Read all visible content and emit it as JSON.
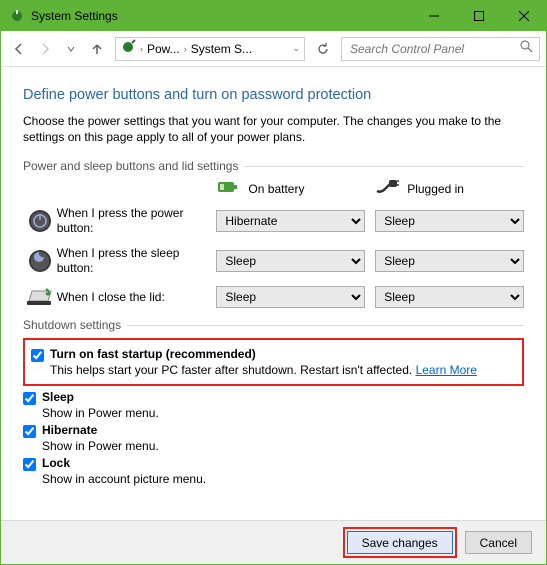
{
  "window": {
    "title": "System Settings"
  },
  "nav": {
    "breadcrumb": {
      "item1": "Pow...",
      "item2": "System S..."
    },
    "search_placeholder": "Search Control Panel"
  },
  "header": {
    "heading": "Define power buttons and turn on password protection",
    "intro": "Choose the power settings that you want for your computer. The changes you make to the settings on this page apply to all of your power plans."
  },
  "section_power": {
    "legend": "Power and sleep buttons and lid settings",
    "col_battery": "On battery",
    "col_plugged": "Plugged in",
    "rows": [
      {
        "label": "When I press the power button:",
        "battery": "Hibernate",
        "plugged": "Sleep"
      },
      {
        "label": "When I press the sleep button:",
        "battery": "Sleep",
        "plugged": "Sleep"
      },
      {
        "label": "When I close the lid:",
        "battery": "Sleep",
        "plugged": "Sleep"
      }
    ]
  },
  "section_shutdown": {
    "legend": "Shutdown settings",
    "fast_startup": {
      "label": "Turn on fast startup (recommended)",
      "desc": "This helps start your PC faster after shutdown. Restart isn't affected. ",
      "link": "Learn More",
      "checked": true
    },
    "sleep": {
      "label": "Sleep",
      "desc": "Show in Power menu.",
      "checked": true
    },
    "hibernate": {
      "label": "Hibernate",
      "desc": "Show in Power menu.",
      "checked": true
    },
    "lock": {
      "label": "Lock",
      "desc": "Show in account picture menu.",
      "checked": true
    }
  },
  "footer": {
    "save": "Save changes",
    "cancel": "Cancel"
  }
}
